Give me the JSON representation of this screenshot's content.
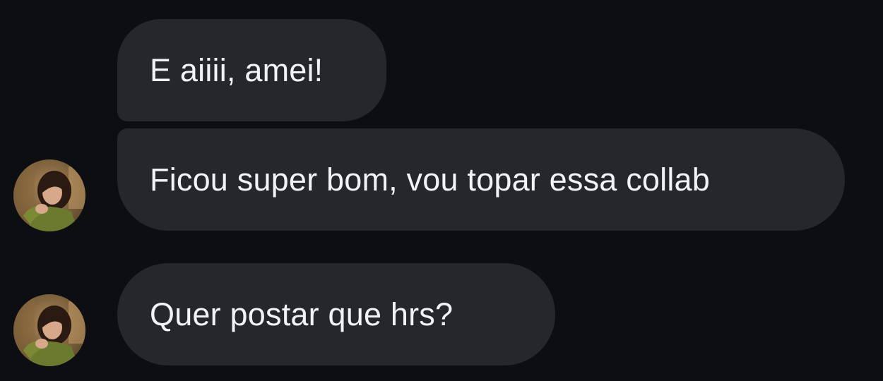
{
  "chat": {
    "messages": [
      {
        "text": "E aiiii, amei!",
        "has_avatar": false
      },
      {
        "text": "Ficou super bom, vou topar essa collab",
        "has_avatar": true
      },
      {
        "text": "Quer postar que hrs?",
        "has_avatar": true
      }
    ],
    "colors": {
      "background": "#0c0e12",
      "bubble": "#25272d",
      "text": "#f2f3f5"
    },
    "avatar_icon": "profile-photo"
  }
}
